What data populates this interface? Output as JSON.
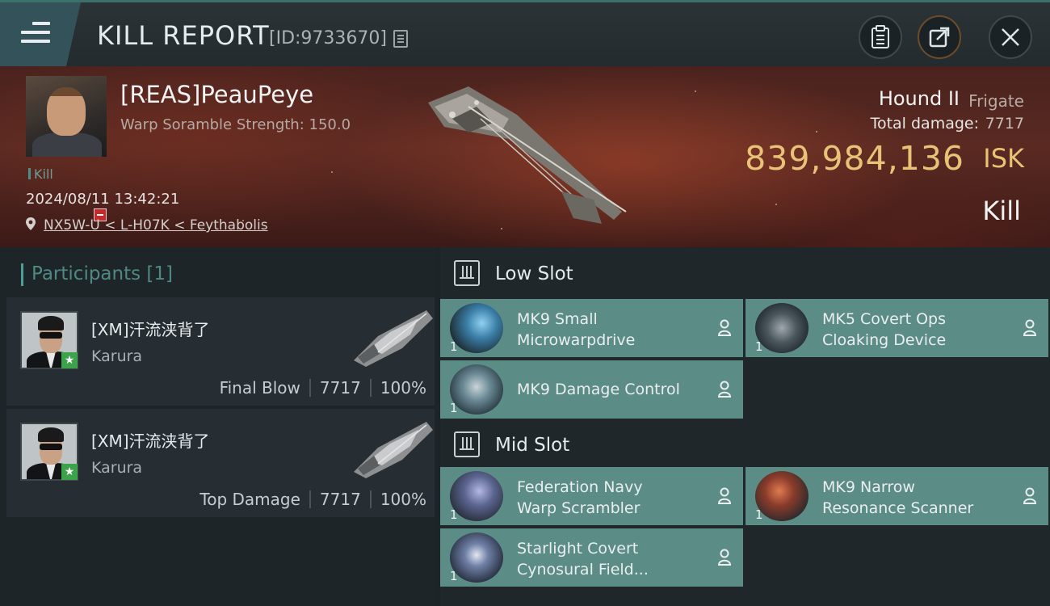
{
  "header": {
    "title": "KILL REPORT",
    "report_id": "[ID:9733670]"
  },
  "victim": {
    "name": "[REAS]PeauPeye",
    "scramble": "Warp Soramble Strength: 150.0",
    "kill_tag": "Kill",
    "date": "2024/08/11 13:42:21",
    "location": "NX5W-U < L-H07K < Feythabolis"
  },
  "ship": {
    "name": "Hound II",
    "class": "Frigate",
    "damage_label": "Total damage:",
    "damage_value": "7717",
    "isk_value": "839,984,136",
    "isk_unit": "ISK",
    "result": "Kill"
  },
  "participants": {
    "header": "Participants [1]",
    "rows": [
      {
        "name": "[XM]汗流浃背了",
        "ship": "Karura",
        "role": "Final Blow",
        "damage": "7717",
        "percent": "100%"
      },
      {
        "name": "[XM]汗流浃背了",
        "ship": "Karura",
        "role": "Top Damage",
        "damage": "7717",
        "percent": "100%"
      }
    ]
  },
  "fitting": {
    "low_slot_label": "Low Slot",
    "mid_slot_label": "Mid Slot",
    "low": [
      {
        "line1": "MK9 Small",
        "line2": "Microwarpdrive",
        "qty": "1",
        "icon": "microwarpdrive-icon"
      },
      {
        "line1": "MK5 Covert Ops",
        "line2": "Cloaking Device",
        "qty": "1",
        "icon": "cloaking-device-icon"
      },
      {
        "line1": "MK9 Damage Control",
        "line2": "",
        "qty": "1",
        "icon": "damage-control-icon"
      }
    ],
    "mid": [
      {
        "line1": "Federation Navy",
        "line2": "Warp Scrambler",
        "qty": "1",
        "icon": "warp-scrambler-icon"
      },
      {
        "line1": "MK9 Narrow",
        "line2": "Resonance Scanner",
        "qty": "1",
        "icon": "resonance-scanner-icon"
      },
      {
        "line1": "Starlight Covert",
        "line2": "Cynosural Field...",
        "qty": "1",
        "icon": "cynosural-field-icon"
      }
    ]
  },
  "colors": {
    "accent": "#4e9e95",
    "isk": "#e8c277",
    "module_bg": "#5c8c86",
    "banner": "#5a2a22"
  }
}
